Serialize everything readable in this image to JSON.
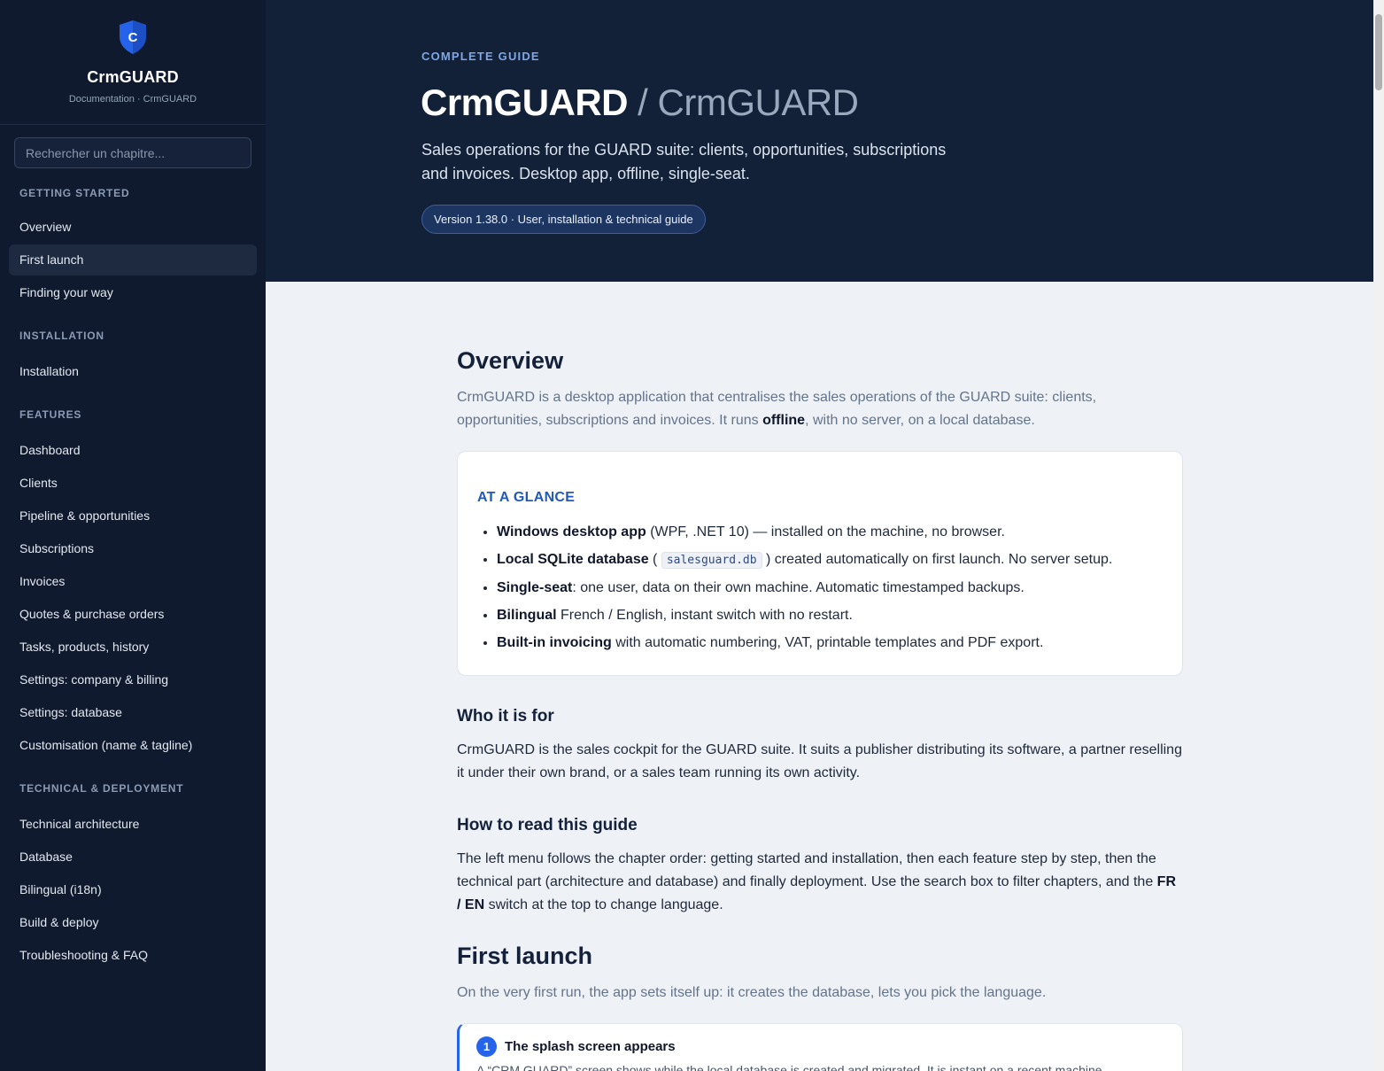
{
  "brand": {
    "logo_letter": "C",
    "name": "CrmGUARD",
    "subtitle": "Documentation · CrmGUARD",
    "accent": "#2563eb"
  },
  "search": {
    "placeholder": "Rechercher un chapitre..."
  },
  "nav": {
    "getting_started": {
      "label": "GETTING STARTED",
      "items": [
        "Overview",
        "First launch",
        "Finding your way"
      ]
    },
    "installation": {
      "label": "INSTALLATION",
      "items": [
        "Installation"
      ]
    },
    "features": {
      "label": "FEATURES",
      "items": [
        "Dashboard",
        "Clients",
        "Pipeline & opportunities",
        "Subscriptions",
        "Invoices",
        "Quotes & purchase orders",
        "Tasks, products, history",
        "Settings: company & billing",
        "Settings: database",
        "Customisation (name & tagline)"
      ]
    },
    "technical": {
      "label": "TECHNICAL & DEPLOYMENT",
      "items": [
        "Technical architecture",
        "Database",
        "Bilingual (i18n)",
        "Build & deploy",
        "Troubleshooting & FAQ"
      ]
    },
    "active_item": "First launch"
  },
  "hero": {
    "eyebrow": "COMPLETE GUIDE",
    "title": "CrmGUARD",
    "title_suffix": " / CrmGUARD",
    "description": "Sales operations for the GUARD suite: clients, opportunities, subscriptions and invoices. Desktop app, offline, single-seat.",
    "version_pill": "Version 1.38.0 · User, installation & technical guide"
  },
  "overview": {
    "heading": "Overview",
    "lead_before": "CrmGUARD is a desktop application that centralises the sales operations of the GUARD suite: clients, opportunities, subscriptions and invoices. It runs ",
    "lead_bold": "offline",
    "lead_after": ", with no server, on a local database.",
    "card": {
      "title": "AT A GLANCE",
      "items": [
        {
          "bold": "Windows desktop app",
          "text": " (WPF, .NET 10) — installed on the machine, no browser."
        },
        {
          "bold": "Local SQLite database",
          "text_before": " ( ",
          "code": "salesguard.db",
          "text": " ) created automatically on first launch. No server setup."
        },
        {
          "bold": "Single-seat",
          "text": ": one user, data on their own machine. Automatic timestamped backups."
        },
        {
          "bold": "Bilingual",
          "text": " French / English, instant switch with no restart."
        },
        {
          "bold": "Built-in invoicing",
          "text": " with automatic numbering, VAT, printable templates and PDF export."
        }
      ]
    }
  },
  "who": {
    "heading": "Who it is for",
    "text": "CrmGUARD is the sales cockpit for the GUARD suite. It suits a publisher distributing its software, a partner reselling it under their own brand, or a sales team running its own activity."
  },
  "how_to_read": {
    "heading": "How to read this guide",
    "text_before": "The left menu follows the chapter order: getting started and installation, then each feature step by step, then the technical part (architecture and database) and finally deployment. Use the search box to filter chapters, and the ",
    "bold": "FR / EN",
    "text_after": " switch at the top to change language."
  },
  "first_launch": {
    "heading": "First launch",
    "lead": "On the very first run, the app sets itself up: it creates the database, lets you pick the language.",
    "step": {
      "number": "1",
      "title": "The splash screen appears",
      "text": "A “CRM GUARD” screen shows while the local database is created and migrated. It is instant on a recent machine."
    }
  }
}
